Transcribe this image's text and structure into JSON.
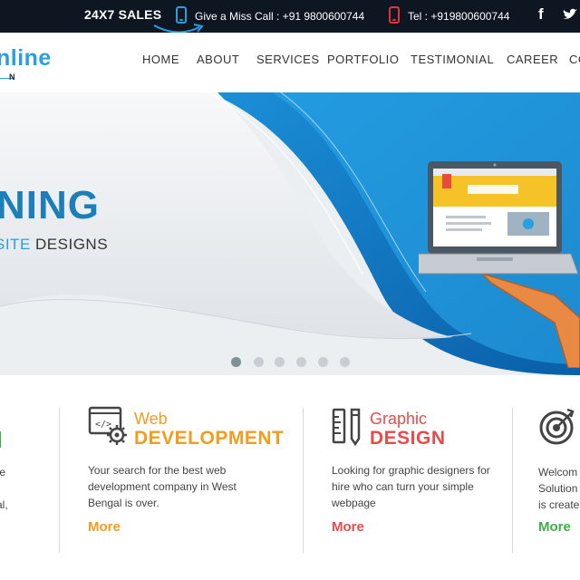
{
  "topbar": {
    "sales": "24X7 SALES",
    "missed_call": "Give a Miss Call : +91 9800600744",
    "telephone": "Tel : +919800600744",
    "facebook_glyph": "f"
  },
  "logo": {
    "text": "nline",
    "sub": "N"
  },
  "nav": {
    "items": [
      "HOME",
      "ABOUT",
      "SERVICES",
      "PORTFOLIO",
      "TESTIMONIAL",
      "CAREER",
      "CO"
    ]
  },
  "hero": {
    "title": "NING",
    "subtitle_highlight": "SITE",
    "subtitle_rest": " DESIGNS",
    "slides": 6,
    "active_slide": 1
  },
  "services": {
    "first_partial": {
      "title": "",
      "lines": [
        "te",
        "t",
        "al,"
      ]
    },
    "web": {
      "title1": "Web",
      "title2": "DEVELOPMENT",
      "desc": "Your search for the best web development company in West Bengal is over.",
      "more": "More"
    },
    "graphic": {
      "title1": "Graphic",
      "title2": "DESIGN",
      "desc": "Looking for graphic designers for hire who can turn your simple webpage",
      "more": "More"
    },
    "last_partial": {
      "lines": [
        "Welcom",
        "Solution",
        "is create"
      ],
      "more": "More"
    }
  },
  "colors": {
    "topbar_bg": "#0e1622",
    "brand_blue": "#2a9fe0",
    "web_orange": "#f39c1e",
    "graphic_red": "#e94b4b",
    "green": "#3fae49"
  }
}
